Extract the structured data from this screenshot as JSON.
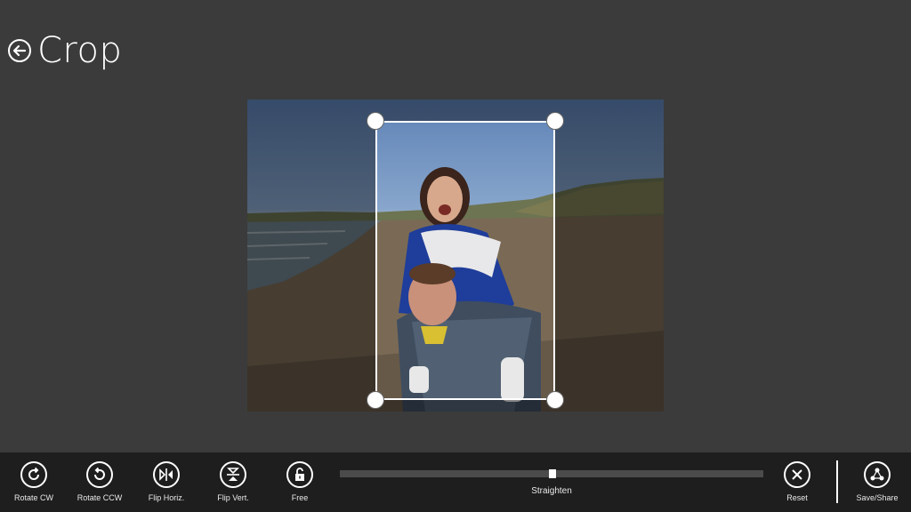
{
  "header": {
    "title": "Crop",
    "back_icon": "back-arrow-icon"
  },
  "toolbar": {
    "rotate_cw": "Rotate CW",
    "rotate_ccw": "Rotate CCW",
    "flip_horizontal": "Flip Horiz.",
    "flip_vertical": "Flip Vert.",
    "free": "Free",
    "straighten": "Straighten",
    "reset": "Reset",
    "save_share": "Save/Share"
  },
  "straighten_value": 0.5,
  "colors": {
    "background": "#3b3b3b",
    "appbar": "#1e1e1e",
    "accent": "#ffffff"
  }
}
